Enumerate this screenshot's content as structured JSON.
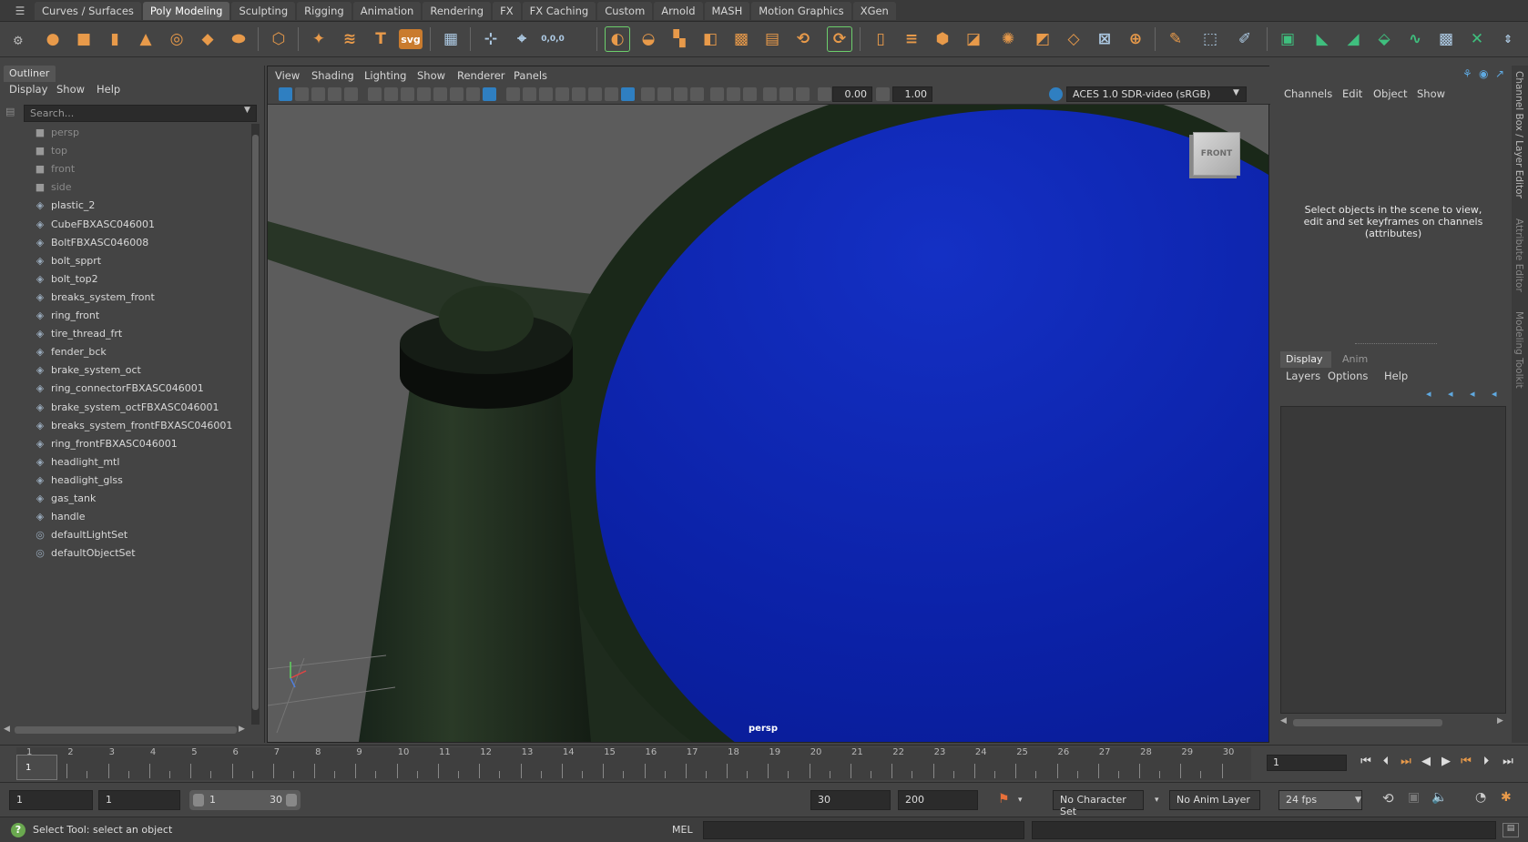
{
  "shelf": {
    "tabs": [
      "Curves / Surfaces",
      "Poly Modeling",
      "Sculpting",
      "Rigging",
      "Animation",
      "Rendering",
      "FX",
      "FX Caching",
      "Custom",
      "Arnold",
      "MASH",
      "Motion Graphics",
      "XGen"
    ],
    "active_tab": "Poly Modeling",
    "svg_icon_text": "svg",
    "t_icon_text": "T",
    "coords_icon_text": "0,0,0"
  },
  "outliner": {
    "tab_label": "Outliner",
    "menu": [
      "Display",
      "Show",
      "Help"
    ],
    "search_placeholder": "Search...",
    "items": [
      {
        "label": "persp",
        "icon": "camera-icon"
      },
      {
        "label": "top",
        "icon": "camera-icon"
      },
      {
        "label": "front",
        "icon": "camera-icon"
      },
      {
        "label": "side",
        "icon": "camera-icon"
      },
      {
        "label": "plastic_2",
        "icon": "mesh-icon"
      },
      {
        "label": "CubeFBXASC046001",
        "icon": "mesh-icon"
      },
      {
        "label": "BoltFBXASC046008",
        "icon": "mesh-icon"
      },
      {
        "label": "bolt_spprt",
        "icon": "mesh-icon"
      },
      {
        "label": "bolt_top2",
        "icon": "mesh-icon"
      },
      {
        "label": "breaks_system_front",
        "icon": "mesh-icon"
      },
      {
        "label": "ring_front",
        "icon": "mesh-icon"
      },
      {
        "label": "tire_thread_frt",
        "icon": "mesh-icon"
      },
      {
        "label": "fender_bck",
        "icon": "mesh-icon"
      },
      {
        "label": "brake_system_oct",
        "icon": "mesh-icon"
      },
      {
        "label": "ring_connectorFBXASC046001",
        "icon": "mesh-icon"
      },
      {
        "label": "brake_system_octFBXASC046001",
        "icon": "mesh-icon"
      },
      {
        "label": "breaks_system_frontFBXASC046001",
        "icon": "mesh-icon"
      },
      {
        "label": "ring_frontFBXASC046001",
        "icon": "mesh-icon"
      },
      {
        "label": "headlight_mtl",
        "icon": "mesh-icon"
      },
      {
        "label": "headlight_glss",
        "icon": "mesh-icon"
      },
      {
        "label": "gas_tank",
        "icon": "mesh-icon"
      },
      {
        "label": "handle",
        "icon": "mesh-icon"
      },
      {
        "label": "defaultLightSet",
        "icon": "set-icon"
      },
      {
        "label": "defaultObjectSet",
        "icon": "set-icon"
      }
    ]
  },
  "viewport": {
    "menu": [
      "View",
      "Shading",
      "Lighting",
      "Show",
      "Renderer",
      "Panels"
    ],
    "exposure": "0.00",
    "gamma": "1.00",
    "color_space": "ACES 1.0 SDR-video (sRGB)",
    "view_cube_label": "FRONT",
    "camera_label": "persp",
    "colors": {
      "bg": "#5d5d5d",
      "tire": "#1d2a1a",
      "headlight": "#0a1fa8",
      "frame": "#243322"
    }
  },
  "channel_box": {
    "menu": [
      "Channels",
      "Edit",
      "Object",
      "Show"
    ],
    "message": "Select objects in the scene to view, edit and set keyframes on channels (attributes)"
  },
  "layer_editor": {
    "tabs": [
      "Display",
      "Anim"
    ],
    "active_tab": "Display",
    "menu": [
      "Layers",
      "Options",
      "Help"
    ]
  },
  "side_tabs": [
    "Channel Box / Layer Editor",
    "Attribute Editor",
    "Modeling Toolkit"
  ],
  "timeslider": {
    "ticks": [
      1,
      2,
      3,
      4,
      5,
      6,
      7,
      8,
      9,
      10,
      11,
      12,
      13,
      14,
      15,
      16,
      17,
      18,
      19,
      20,
      21,
      22,
      23,
      24,
      25,
      26,
      27,
      28,
      29,
      30
    ],
    "current_frame_marker": "1",
    "current_frame": "1"
  },
  "range": {
    "start": "1",
    "playback_start": "1",
    "slider_start": "1",
    "slider_end": "30",
    "playback_end": "30",
    "end": "200",
    "character_set": "No Character Set",
    "anim_layer": "No Anim Layer",
    "fps": "24 fps"
  },
  "status": {
    "help_text": "Select Tool: select an object",
    "mel_label": "MEL"
  }
}
